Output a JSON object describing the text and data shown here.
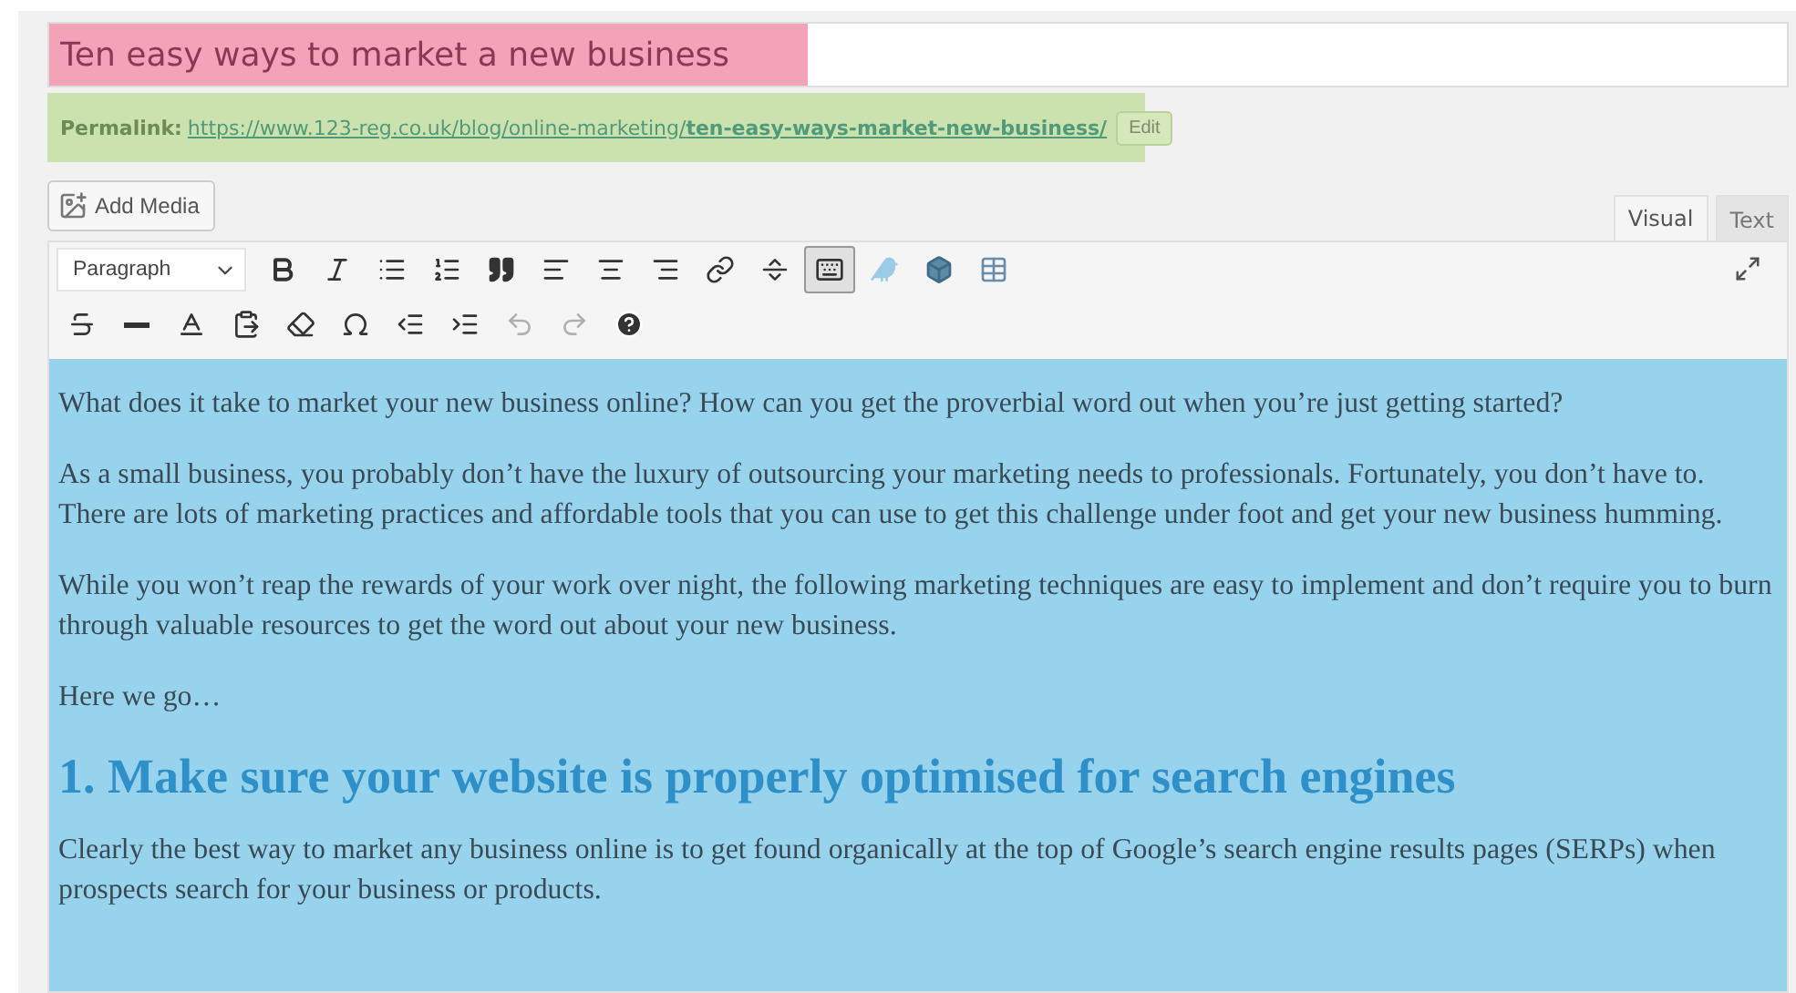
{
  "title_field": {
    "value": "Ten easy ways to market a new business"
  },
  "permalink": {
    "label": "Permalink:",
    "url_start": "https://www.123-reg.co.uk/blog/online-marketing/",
    "url_slug": "ten-easy-ways-market-new-business/",
    "edit_button": "Edit"
  },
  "add_media_button": "Add Media",
  "editor_tabs": [
    {
      "label": "Visual",
      "selected": true
    },
    {
      "label": "Text",
      "selected": false
    }
  ],
  "toolbar_rows": [
    [
      {
        "kind": "format",
        "label": "Paragraph"
      },
      {
        "kind": "bold",
        "pressed": false,
        "disabled": false
      },
      {
        "kind": "italic",
        "pressed": false,
        "disabled": false
      },
      {
        "kind": "bullets",
        "pressed": false,
        "disabled": false
      },
      {
        "kind": "numbers",
        "pressed": false,
        "disabled": false
      },
      {
        "kind": "quote",
        "pressed": false,
        "disabled": false
      },
      {
        "kind": "align-left",
        "pressed": false,
        "disabled": false
      },
      {
        "kind": "align-center",
        "pressed": false,
        "disabled": false
      },
      {
        "kind": "align-right",
        "pressed": false,
        "disabled": false
      },
      {
        "kind": "link",
        "pressed": false,
        "disabled": false
      },
      {
        "kind": "more",
        "pressed": false,
        "disabled": false
      },
      {
        "kind": "toolbar-toggle",
        "pressed": true,
        "disabled": false
      },
      {
        "kind": "bird",
        "pressed": false,
        "disabled": false
      },
      {
        "kind": "cube",
        "pressed": false,
        "disabled": false
      },
      {
        "kind": "table",
        "pressed": false,
        "disabled": false
      }
    ],
    [
      {
        "kind": "strike",
        "pressed": false,
        "disabled": false
      },
      {
        "kind": "hr",
        "pressed": false,
        "disabled": false
      },
      {
        "kind": "text-color",
        "pressed": false,
        "disabled": false
      },
      {
        "kind": "paste",
        "pressed": false,
        "disabled": false
      },
      {
        "kind": "eraser",
        "pressed": false,
        "disabled": false
      },
      {
        "kind": "omega",
        "pressed": false,
        "disabled": false
      },
      {
        "kind": "outdent",
        "pressed": false,
        "disabled": false
      },
      {
        "kind": "indent",
        "pressed": false,
        "disabled": false
      },
      {
        "kind": "undo",
        "pressed": false,
        "disabled": true
      },
      {
        "kind": "redo",
        "pressed": false,
        "disabled": true
      },
      {
        "kind": "help",
        "pressed": false,
        "disabled": false
      }
    ]
  ],
  "content": {
    "selected": true,
    "blocks": [
      {
        "kind": "p",
        "text": "What does it take to market your new business online? How can you get the proverbial word out when you’re just getting started?"
      },
      {
        "kind": "p",
        "text": "As a small business, you probably don’t have the luxury of outsourcing your marketing needs to professionals. Fortunately, you don’t have to. There are lots of marketing practices and affordable tools that you can use to get this challenge under foot and get your new business humming."
      },
      {
        "kind": "p",
        "text": "While you won’t reap the rewards of your work over night, the following marketing techniques are easy to implement and don’t require you to burn through valuable resources to get the word out about your new business."
      },
      {
        "kind": "p",
        "text": "Here we go…"
      },
      {
        "kind": "h2",
        "text": "1. Make sure your website is properly optimised for search engines"
      },
      {
        "kind": "p",
        "text": "Clearly the best way to market any business online is to get found organically at the top of Google’s search engine results pages (SERPs) when prospects search for your business or products."
      }
    ]
  }
}
